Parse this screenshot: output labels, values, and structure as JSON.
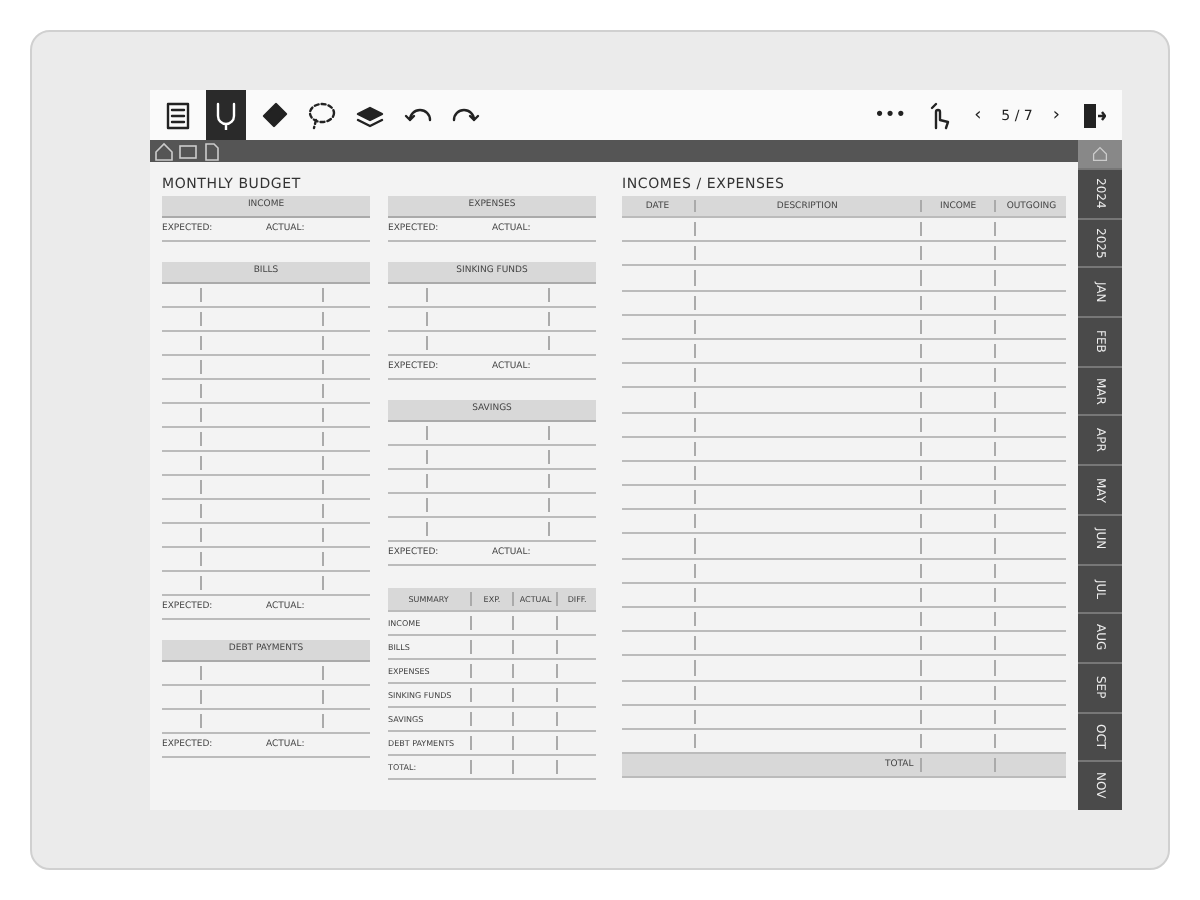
{
  "toolbar": {
    "tools": [
      {
        "kind": "list",
        "selected": false
      },
      {
        "kind": "pen",
        "selected": true
      },
      {
        "kind": "eraser",
        "selected": false
      },
      {
        "kind": "lasso",
        "selected": false
      },
      {
        "kind": "layers",
        "selected": false
      },
      {
        "kind": "undo",
        "selected": false
      },
      {
        "kind": "redo",
        "selected": false
      }
    ],
    "more": "•••",
    "prev": "‹",
    "page_indicator": "5 / 7",
    "next": "›"
  },
  "side_tabs": [
    {
      "label": "2024",
      "selected": false
    },
    {
      "label": "2025",
      "selected": false
    },
    {
      "label": "JAN",
      "selected": false
    },
    {
      "label": "FEB",
      "selected": false
    },
    {
      "label": "MAR",
      "selected": false
    },
    {
      "label": "APR",
      "selected": false
    },
    {
      "label": "MAY",
      "selected": false
    },
    {
      "label": "JUN",
      "selected": false
    },
    {
      "label": "JUL",
      "selected": false
    },
    {
      "label": "AUG",
      "selected": false
    },
    {
      "label": "SEP",
      "selected": false
    },
    {
      "label": "OCT",
      "selected": false
    },
    {
      "label": "NOV",
      "selected": false
    }
  ],
  "monthly_budget": {
    "title": "MONTHLY BUDGET",
    "columns": [
      [
        {
          "kind": "section",
          "header": "INCOME",
          "expected": "EXPECTED:",
          "actual": "ACTUAL:"
        },
        {
          "kind": "section",
          "header": "BILLS",
          "rows": [
            {
              "kind": "line"
            },
            {
              "kind": "line"
            },
            {
              "kind": "line"
            },
            {
              "kind": "line"
            },
            {
              "kind": "line"
            },
            {
              "kind": "line"
            },
            {
              "kind": "line"
            },
            {
              "kind": "line"
            },
            {
              "kind": "line"
            },
            {
              "kind": "line"
            },
            {
              "kind": "line"
            },
            {
              "kind": "line"
            },
            {
              "kind": "line"
            }
          ],
          "expected": "EXPECTED:",
          "actual": "ACTUAL:"
        },
        {
          "kind": "section",
          "header": "DEBT PAYMENTS",
          "rows": [
            {
              "kind": "line"
            },
            {
              "kind": "line"
            },
            {
              "kind": "line"
            }
          ],
          "expected": "EXPECTED:",
          "actual": "ACTUAL:"
        }
      ],
      [
        {
          "kind": "section",
          "header": "EXPENSES",
          "expected": "EXPECTED:",
          "actual": "ACTUAL:"
        },
        {
          "kind": "section",
          "header": "SINKING FUNDS",
          "rows": [
            {
              "kind": "line"
            },
            {
              "kind": "line"
            },
            {
              "kind": "line"
            }
          ],
          "expected": "EXPECTED:",
          "actual": "ACTUAL:"
        },
        {
          "kind": "section",
          "header": "SAVINGS",
          "rows": [
            {
              "kind": "line"
            },
            {
              "kind": "line"
            },
            {
              "kind": "line"
            },
            {
              "kind": "line"
            },
            {
              "kind": "line"
            }
          ],
          "expected": "EXPECTED:",
          "actual": "ACTUAL:"
        },
        {
          "kind": "summary",
          "columns": [
            "SUMMARY",
            "EXP.",
            "ACTUAL",
            "DIFF."
          ],
          "rows": [
            "INCOME",
            "BILLS",
            "EXPENSES",
            "SINKING FUNDS",
            "SAVINGS",
            "DEBT PAYMENTS",
            "TOTAL:"
          ]
        }
      ]
    ]
  },
  "incomes_expenses": {
    "title": "INCOMES / EXPENSES",
    "columns": [
      "DATE",
      "DESCRIPTION",
      "INCOME",
      "OUTGOING"
    ],
    "rows": [
      {
        "kind": "line"
      },
      {
        "kind": "line"
      },
      {
        "kind": "line"
      },
      {
        "kind": "line"
      },
      {
        "kind": "line"
      },
      {
        "kind": "line"
      },
      {
        "kind": "line"
      },
      {
        "kind": "line"
      },
      {
        "kind": "line"
      },
      {
        "kind": "line"
      },
      {
        "kind": "line"
      },
      {
        "kind": "line"
      },
      {
        "kind": "line"
      },
      {
        "kind": "line"
      },
      {
        "kind": "line"
      },
      {
        "kind": "line"
      },
      {
        "kind": "line"
      },
      {
        "kind": "line"
      },
      {
        "kind": "line"
      },
      {
        "kind": "line"
      },
      {
        "kind": "line"
      },
      {
        "kind": "line"
      }
    ],
    "total": "TOTAL"
  }
}
